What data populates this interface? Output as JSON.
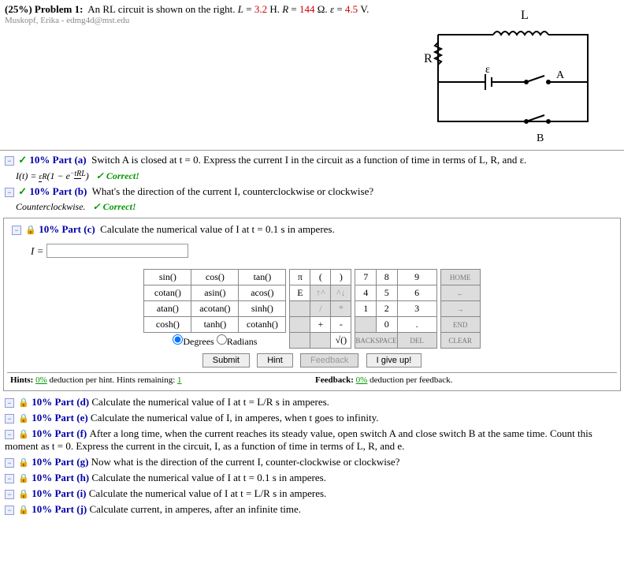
{
  "problem": {
    "weight": "(25%)",
    "label": "Problem 1:",
    "text": "An RL circuit is shown on the right.",
    "L_label": "L",
    "L_val": "3.2",
    "L_unit": "H.",
    "R_label": "R",
    "R_val": "144",
    "R_unit": "Ω.",
    "e_label": "ε",
    "e_val": "4.5",
    "e_unit": "V.",
    "attribution": "Muskopf, Erika - edmg4d@mst.edu"
  },
  "parts": {
    "a": {
      "pct": "10%",
      "label": "Part (a)",
      "text": "Switch A is closed at t = 0. Express the current I in the circuit as a function of time in terms of L, R, and ε.",
      "answer_lhs": "I(t) =",
      "correct": "✓ Correct!"
    },
    "b": {
      "pct": "10%",
      "label": "Part (b)",
      "text": "What's the direction of the current I, counterclockwise or clockwise?",
      "answer": "Counterclockwise.",
      "correct": "✓ Correct!"
    },
    "c": {
      "pct": "10%",
      "label": "Part (c)",
      "text": "Calculate the numerical value of I at t = 0.1 s in amperes.",
      "var": "I ="
    },
    "d": {
      "pct": "10%",
      "label": "Part (d)",
      "text": "Calculate the numerical value of I at t = L/R s in amperes."
    },
    "e": {
      "pct": "10%",
      "label": "Part (e)",
      "text": "Calculate the numerical value of I, in amperes, when t goes to infinity."
    },
    "f": {
      "pct": "10%",
      "label": "Part (f)",
      "text": "After a long time, when the current reaches its steady value, open switch A and close switch B at the same time. Count this moment as t = 0. Express the current in the circuit, I, as a function of time in terms of L, R, and e."
    },
    "g": {
      "pct": "10%",
      "label": "Part (g)",
      "text": "Now what is the direction of the current I, counter-clockwise or clockwise?"
    },
    "h": {
      "pct": "10%",
      "label": "Part (h)",
      "text": "Calculate the numerical value of I at t = 0.1 s in amperes."
    },
    "i": {
      "pct": "10%",
      "label": "Part (i)",
      "text": "Calculate the numerical value of I at t = L/R s in amperes."
    },
    "j": {
      "pct": "10%",
      "label": "Part (j)",
      "text": "Calculate current, in amperes, after an infinite time."
    }
  },
  "keypad": {
    "func": [
      [
        "sin()",
        "cos()",
        "tan()"
      ],
      [
        "cotan()",
        "asin()",
        "acos()"
      ],
      [
        "atan()",
        "acotan()",
        "sinh()"
      ],
      [
        "cosh()",
        "tanh()",
        "cotanh()"
      ]
    ],
    "sym": [
      [
        "π",
        "(",
        ")"
      ],
      [
        "E",
        "↑^",
        "^↓"
      ],
      [
        "",
        "/",
        "*"
      ],
      [
        "",
        "+",
        "-"
      ],
      [
        "",
        "",
        "√()"
      ]
    ],
    "num": [
      [
        "7",
        "8",
        "9"
      ],
      [
        "4",
        "5",
        "6"
      ],
      [
        "1",
        "2",
        "3"
      ],
      [
        "",
        "0",
        "."
      ]
    ],
    "side": [
      "HOME",
      "←",
      "→",
      "END"
    ],
    "bottom": [
      "BACKSPACE",
      "DEL",
      "CLEAR"
    ],
    "deg": "Degrees",
    "rad": "Radians"
  },
  "buttons": {
    "submit": "Submit",
    "hint": "Hint",
    "feedback": "Feedback",
    "giveup": "I give up!"
  },
  "hints": {
    "left_pre": "Hints:",
    "left_pct": "0%",
    "left_mid": "deduction per hint. Hints remaining:",
    "left_n": "1",
    "right_pre": "Feedback:",
    "right_pct": "0%",
    "right_post": "deduction per feedback."
  },
  "circuit_labels": {
    "L": "L",
    "R": "R",
    "e": "ε",
    "A": "A",
    "B": "B"
  }
}
